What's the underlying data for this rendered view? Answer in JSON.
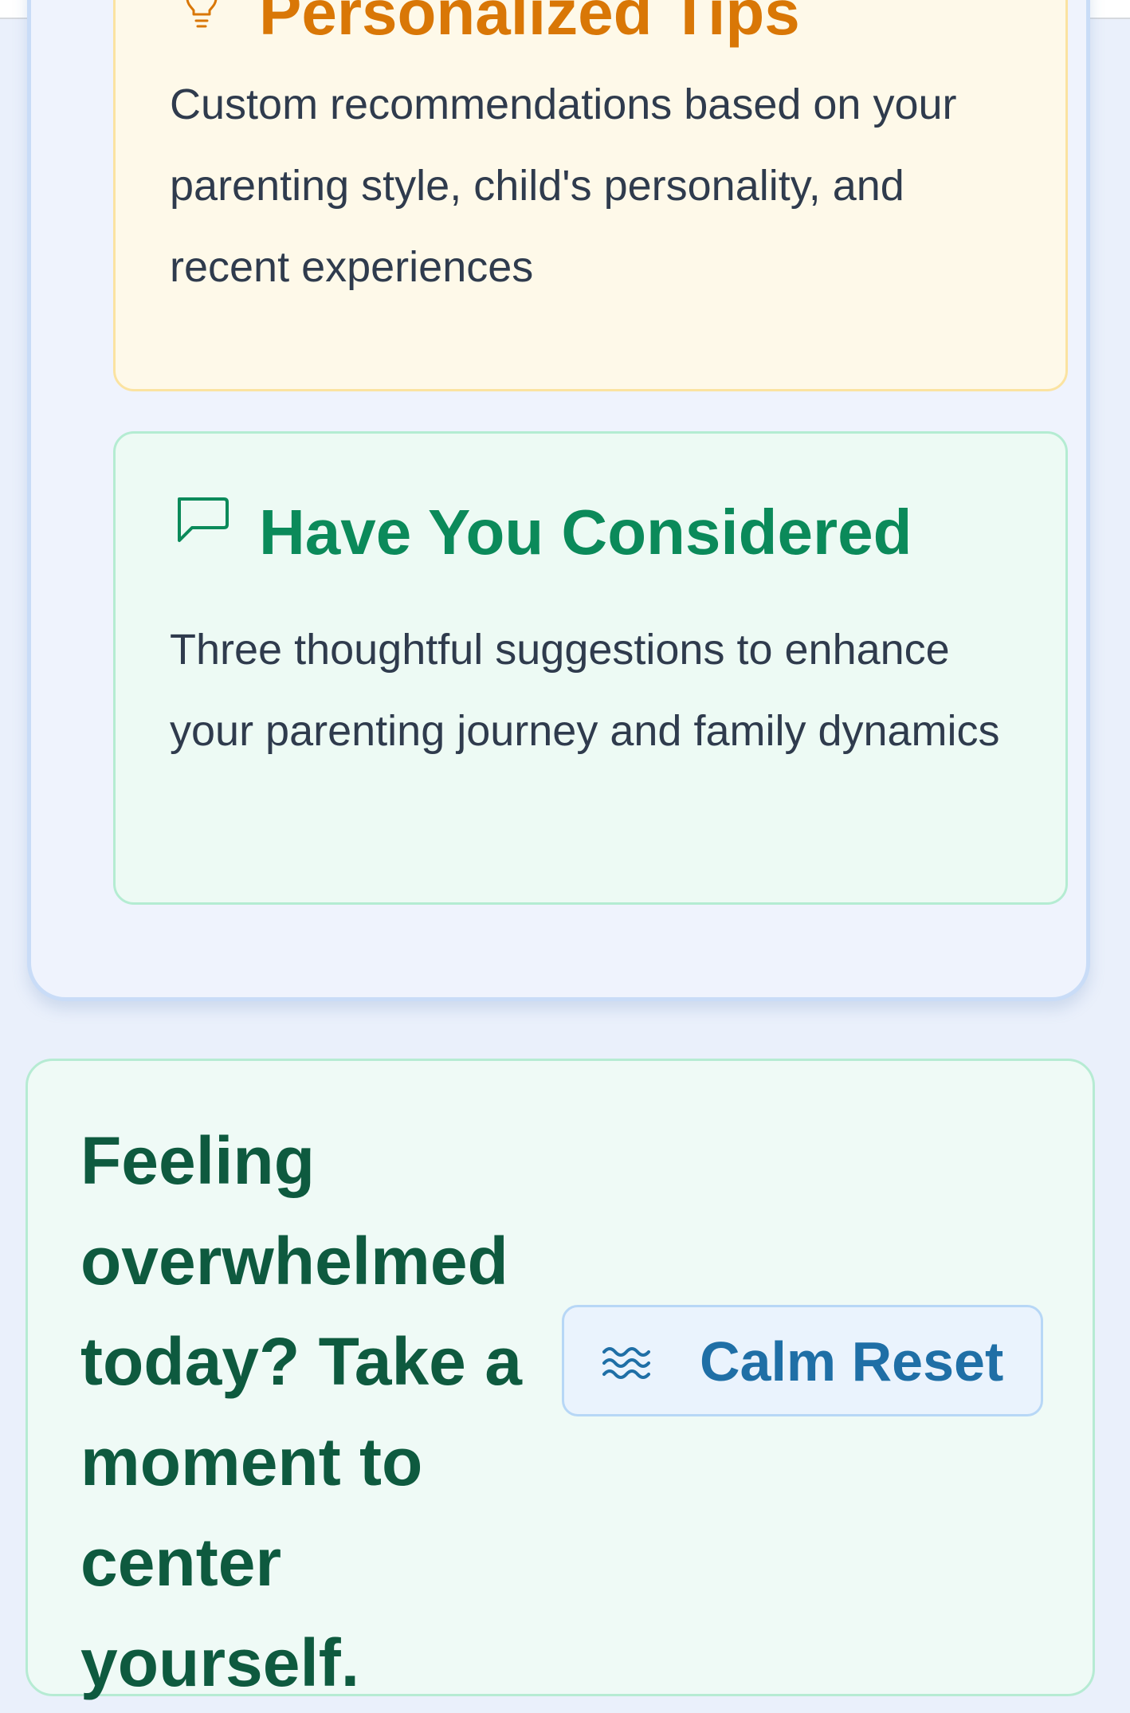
{
  "personalized_tips": {
    "icon": "lightbulb-icon",
    "title": "Personalized Tips",
    "description": "Custom recommendations based on your parenting style, child's personality, and recent experiences",
    "accent_color": "#d97706",
    "background_color": "#fef9e9"
  },
  "have_you_considered": {
    "icon": "message-square-icon",
    "title": "Have You Considered",
    "description": "Three thoughtful suggestions to enhance your parenting journey and family dynamics",
    "accent_color": "#0b8a5a",
    "background_color": "#edfaf4"
  },
  "calm_reset": {
    "prompt": "Feeling overwhelmed today? Take a moment to center yourself.",
    "button_label": "Calm Reset",
    "button_icon": "waves-icon",
    "text_color": "#0e5a3f",
    "button_color": "#1f6fa6"
  }
}
